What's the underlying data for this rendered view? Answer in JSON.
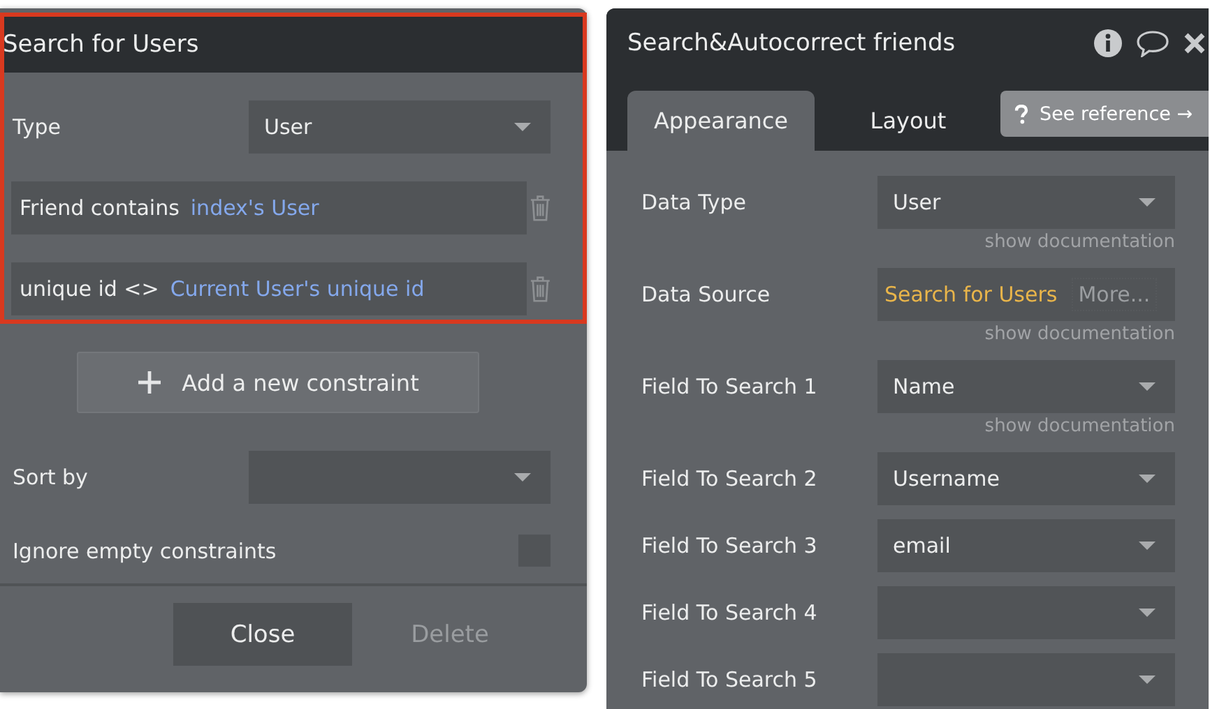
{
  "search_dialog": {
    "title": "Search for Users",
    "highlighted": true,
    "type": {
      "label": "Type",
      "value": "User"
    },
    "constraints": [
      {
        "field": "Friend contains",
        "value": "index's User"
      },
      {
        "field": "unique id <>",
        "value": "Current User's unique id"
      }
    ],
    "add_button": "Add a new constraint",
    "sort_by": {
      "label": "Sort by"
    },
    "ignore_empty": {
      "label": "Ignore empty constraints",
      "checked": false
    },
    "buttons": [
      {
        "label": "Close",
        "disabled": false
      },
      {
        "label": "Delete",
        "disabled": true
      }
    ]
  },
  "element_panel": {
    "title": "Search&Autocorrect friends",
    "tabs": [
      {
        "label": "Appearance",
        "selected": true
      },
      {
        "label": "Layout",
        "selected": false
      }
    ],
    "reference_button": "See reference →",
    "properties": [
      {
        "label": "Data Type",
        "kind": "dropdown",
        "value": "User",
        "documentation": "show documentation"
      },
      {
        "label": "Data Source",
        "kind": "expression",
        "value": "Search for Users",
        "extra": "More...",
        "documentation": "show documentation"
      },
      {
        "label": "Field To Search 1",
        "kind": "dropdown",
        "value": "Name",
        "documentation": "show documentation"
      },
      {
        "label": "Field To Search 2",
        "kind": "dropdown",
        "value": "Username"
      },
      {
        "label": "Field To Search 3",
        "kind": "dropdown",
        "value": "email"
      },
      {
        "label": "Field To Search 4",
        "kind": "dropdown"
      },
      {
        "label": "Field To Search 5",
        "kind": "dropdown"
      }
    ]
  }
}
